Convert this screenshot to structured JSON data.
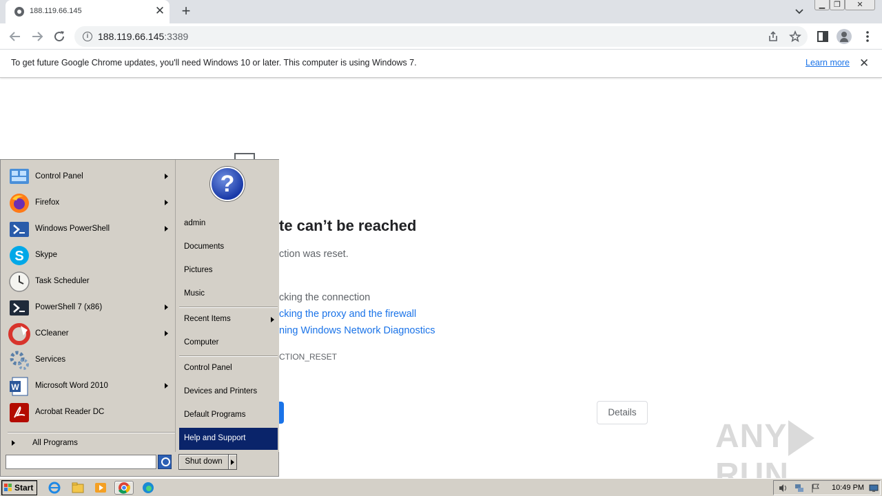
{
  "browser": {
    "tab_title": "188.119.66.145",
    "tab_close": "✕",
    "new_tab": "+",
    "url_host": "188.119.66.145",
    "url_port": ":3389",
    "info_icon": "i",
    "icons": [
      "back-arrow-icon",
      "forward-arrow-icon",
      "reload-icon",
      "share-icon",
      "star-icon",
      "sidepanel-icon",
      "profile-icon",
      "more-vert-icon"
    ]
  },
  "infobar": {
    "text": "To get future Google Chrome updates, you'll need Windows 10 or later. This computer is using Windows 7.",
    "learn_more": "Learn more",
    "close": "✕"
  },
  "error_page": {
    "title": "te can’t be reached",
    "subtitle": "ction was reset.",
    "try_lines": [
      {
        "text": "cking the connection",
        "link": false
      },
      {
        "text": "cking the proxy and the firewall",
        "link": true
      },
      {
        "text": "ning Windows Network Diagnostics",
        "link": true
      }
    ],
    "error_code": "CTION_RESET",
    "details_button": "Details"
  },
  "watermark": {
    "left": "ANY",
    "right": "RUN"
  },
  "start_menu": {
    "programs": [
      {
        "label": "Control Panel",
        "arrow": true,
        "icon": "control-panel-icon"
      },
      {
        "label": "Firefox",
        "arrow": true,
        "icon": "firefox-icon"
      },
      {
        "label": "Windows PowerShell",
        "arrow": true,
        "icon": "powershell-icon"
      },
      {
        "label": "Skype",
        "arrow": false,
        "icon": "skype-icon"
      },
      {
        "label": "Task Scheduler",
        "arrow": false,
        "icon": "task-scheduler-icon"
      },
      {
        "label": "PowerShell 7 (x86)",
        "arrow": true,
        "icon": "powershell7-icon"
      },
      {
        "label": "CCleaner",
        "arrow": true,
        "icon": "ccleaner-icon"
      },
      {
        "label": "Services",
        "arrow": false,
        "icon": "services-icon"
      },
      {
        "label": "Microsoft Word 2010",
        "arrow": true,
        "icon": "word-icon"
      },
      {
        "label": "Acrobat Reader DC",
        "arrow": false,
        "icon": "acrobat-icon"
      }
    ],
    "all_programs": "All Programs",
    "help_orb": "?",
    "right_items": [
      {
        "label": "admin"
      },
      {
        "label": "Documents"
      },
      {
        "label": "Pictures"
      },
      {
        "label": "Music"
      },
      {
        "label": "Recent Items",
        "arrow": true
      },
      {
        "label": "Computer"
      },
      {
        "label": "Control Panel"
      },
      {
        "label": "Devices and Printers"
      },
      {
        "label": "Default Programs"
      },
      {
        "label": "Help and Support",
        "selected": true
      }
    ],
    "search_value": "",
    "shutdown_label": "Shut down"
  },
  "taskbar": {
    "start_label": "Start",
    "apps": [
      "ie-icon",
      "explorer-icon",
      "media-player-icon",
      "chrome-icon",
      "edge-icon"
    ],
    "tray_icons": [
      "volume-icon",
      "network-icon",
      "flag-icon",
      "display-icon"
    ],
    "clock": "10:49 PM"
  }
}
